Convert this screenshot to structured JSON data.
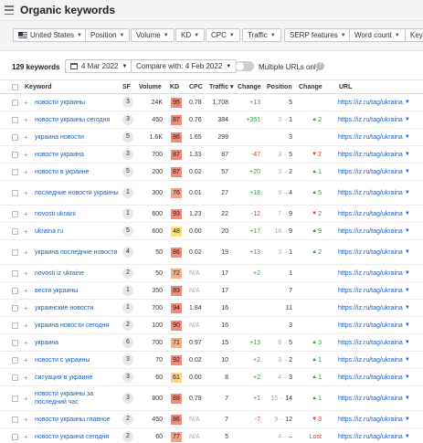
{
  "title": "Organic keywords",
  "filters": {
    "country": "United States",
    "position": "Position",
    "volume": "Volume",
    "kd": "KD",
    "cpc": "CPC",
    "traffic": "Traffic",
    "serp": "SERP features",
    "word_count": "Word count",
    "more": "Key"
  },
  "toolbar": {
    "count": "129 keywords",
    "date": "4 Mar 2022",
    "compare": "Compare with: 4 Feb 2022",
    "multi_urls": "Multiple URLs only"
  },
  "columns": {
    "keyword": "Keyword",
    "sf": "SF",
    "volume": "Volume",
    "kd": "KD",
    "cpc": "CPC",
    "traffic": "Traffic ▾",
    "change": "Change",
    "position": "Position",
    "pos_change": "Change",
    "url": "URL"
  },
  "kd_colors": {
    "high": "#ef8b7a",
    "mid_high": "#f2a08a",
    "mid": "#f5b18a",
    "low": "#f8d38a",
    "yellow": "#f9e07a"
  },
  "rows": [
    {
      "keyword": "новости украины",
      "sf": "3",
      "volume": "24K",
      "kd": "95",
      "cpc": "0.78",
      "traffic": "1,708",
      "change": "+13",
      "change_dir": "up",
      "pos_old": "",
      "pos_new": "5",
      "pos_change": "",
      "pos_dir": "",
      "url": "https://iz.ru/tag/ukraina"
    },
    {
      "keyword": "новости украины сегодня",
      "sf": "3",
      "volume": "450",
      "kd": "87",
      "cpc": "0.76",
      "traffic": "384",
      "change": "+351",
      "change_dir": "up",
      "pos_old": "3",
      "pos_new": "1",
      "pos_change": "2",
      "pos_dir": "up",
      "url": "https://iz.ru/tag/ukraina"
    },
    {
      "keyword": "украина новости",
      "sf": "5",
      "volume": "1.6K",
      "kd": "86",
      "cpc": "1.65",
      "traffic": "299",
      "change": "",
      "change_dir": "",
      "pos_old": "",
      "pos_new": "3",
      "pos_change": "",
      "pos_dir": "",
      "url": "https://iz.ru/tag/ukraina"
    },
    {
      "keyword": "новости украина",
      "sf": "3",
      "volume": "700",
      "kd": "87",
      "cpc": "1.33",
      "traffic": "87",
      "change": "-47",
      "change_dir": "down",
      "pos_old": "3",
      "pos_new": "5",
      "pos_change": "2",
      "pos_dir": "down",
      "url": "https://iz.ru/tag/ukraina"
    },
    {
      "keyword": "новости в украине",
      "sf": "5",
      "volume": "200",
      "kd": "87",
      "cpc": "0.02",
      "traffic": "57",
      "change": "+20",
      "change_dir": "up",
      "pos_old": "3",
      "pos_new": "2",
      "pos_change": "1",
      "pos_dir": "up",
      "url": "https://iz.ru/tag/ukraina"
    },
    {
      "keyword": "последние новости украины",
      "sf": "1",
      "volume": "300",
      "kd": "76",
      "cpc": "0.01",
      "traffic": "27",
      "change": "+18",
      "change_dir": "up",
      "pos_old": "9",
      "pos_new": "4",
      "pos_change": "5",
      "pos_dir": "up",
      "url": "https://iz.ru/tag/ukraina"
    },
    {
      "keyword": "novosti ukraini",
      "sf": "1",
      "volume": "600",
      "kd": "93",
      "cpc": "1.23",
      "traffic": "22",
      "change": "-12",
      "change_dir": "down",
      "pos_old": "7",
      "pos_new": "9",
      "pos_change": "2",
      "pos_dir": "down",
      "url": "https://iz.ru/tag/ukraina"
    },
    {
      "keyword": "ukraina ru",
      "sf": "5",
      "volume": "600",
      "kd": "48",
      "cpc": "0.00",
      "traffic": "20",
      "change": "+17",
      "change_dir": "up",
      "pos_old": "18",
      "pos_new": "9",
      "pos_change": "9",
      "pos_dir": "up",
      "url": "https://iz.ru/tag/ukraina"
    },
    {
      "keyword": "украина последние новости",
      "sf": "4",
      "volume": "50",
      "kd": "86",
      "cpc": "0.02",
      "traffic": "19",
      "change": "+13",
      "change_dir": "up",
      "pos_old": "3",
      "pos_new": "1",
      "pos_change": "2",
      "pos_dir": "up",
      "url": "https://iz.ru/tag/ukraina"
    },
    {
      "keyword": "novosti iz ukraine",
      "sf": "2",
      "volume": "50",
      "kd": "72",
      "cpc": "N/A",
      "traffic": "17",
      "change": "+2",
      "change_dir": "up",
      "pos_old": "",
      "pos_new": "1",
      "pos_change": "",
      "pos_dir": "",
      "url": "https://iz.ru/tag/ukraina"
    },
    {
      "keyword": "вести украины",
      "sf": "1",
      "volume": "350",
      "kd": "89",
      "cpc": "N/A",
      "traffic": "17",
      "change": "",
      "change_dir": "",
      "pos_old": "",
      "pos_new": "7",
      "pos_change": "",
      "pos_dir": "",
      "url": "https://iz.ru/tag/ukraina"
    },
    {
      "keyword": "украинские новости",
      "sf": "1",
      "volume": "700",
      "kd": "94",
      "cpc": "1.84",
      "traffic": "16",
      "change": "",
      "change_dir": "",
      "pos_old": "",
      "pos_new": "11",
      "pos_change": "",
      "pos_dir": "",
      "url": "https://iz.ru/tag/ukraina"
    },
    {
      "keyword": "украина новости сегодня",
      "sf": "2",
      "volume": "100",
      "kd": "90",
      "cpc": "N/A",
      "traffic": "16",
      "change": "",
      "change_dir": "",
      "pos_old": "",
      "pos_new": "3",
      "pos_change": "",
      "pos_dir": "",
      "url": "https://iz.ru/tag/ukraina"
    },
    {
      "keyword": "украина",
      "sf": "6",
      "volume": "700",
      "kd": "71",
      "cpc": "0.97",
      "traffic": "15",
      "change": "+13",
      "change_dir": "up",
      "pos_old": "8",
      "pos_new": "5",
      "pos_change": "3",
      "pos_dir": "up",
      "url": "https://iz.ru/tag/ukraina"
    },
    {
      "keyword": "новости с украины",
      "sf": "3",
      "volume": "70",
      "kd": "92",
      "cpc": "0.02",
      "traffic": "10",
      "change": "+2",
      "change_dir": "up",
      "pos_old": "3",
      "pos_new": "2",
      "pos_change": "1",
      "pos_dir": "up",
      "url": "https://iz.ru/tag/ukraina"
    },
    {
      "keyword": "ситуация в украине",
      "sf": "3",
      "volume": "60",
      "kd": "61",
      "cpc": "0.00",
      "traffic": "8",
      "change": "+2",
      "change_dir": "up",
      "pos_old": "4",
      "pos_new": "3",
      "pos_change": "1",
      "pos_dir": "up",
      "url": "https://iz.ru/tag/ukraina"
    },
    {
      "keyword": "новости украины за последний час",
      "sf": "3",
      "volume": "800",
      "kd": "88",
      "cpc": "0.79",
      "traffic": "7",
      "change": "+1",
      "change_dir": "up",
      "pos_old": "15",
      "pos_new": "14",
      "pos_change": "1",
      "pos_dir": "up",
      "url": "https://iz.ru/tag/ukraina"
    },
    {
      "keyword": "новости украины главное",
      "sf": "2",
      "volume": "450",
      "kd": "86",
      "cpc": "N/A",
      "traffic": "7",
      "change": "-7",
      "change_dir": "down",
      "pos_old": "9",
      "pos_new": "12",
      "pos_change": "3",
      "pos_dir": "down",
      "url": "https://iz.ru/tag/ukraina"
    },
    {
      "keyword": "новости украина сегодня",
      "sf": "2",
      "volume": "60",
      "kd": "77",
      "cpc": "N/A",
      "traffic": "5",
      "change": "",
      "change_dir": "",
      "pos_old": "4",
      "pos_new": "",
      "pos_change": "Lost",
      "pos_dir": "lost",
      "url": "https://iz.ru/tag/ukraina"
    }
  ]
}
